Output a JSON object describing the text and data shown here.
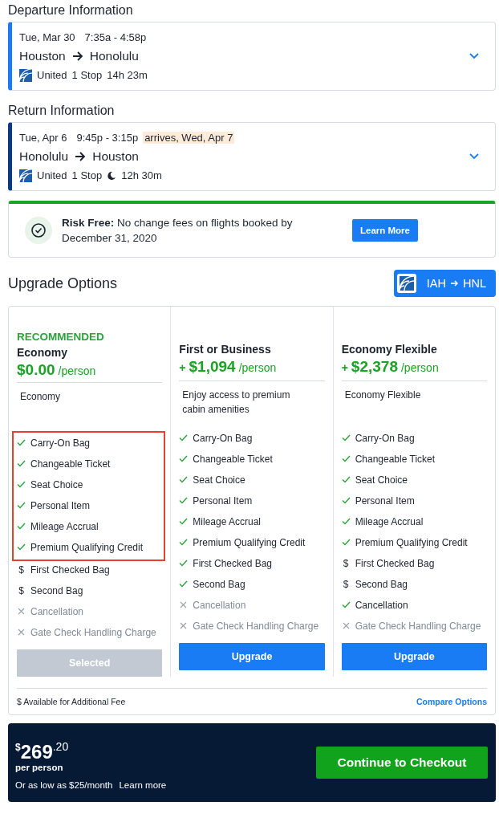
{
  "legs": [
    {
      "heading": "Departure Information",
      "color": "#1a7cf5",
      "date": "Tue, Mar 30",
      "times": "7:35a - 4:58p",
      "from": "Houston",
      "to": "Honolulu",
      "airline": "United",
      "stops": "1 Stop",
      "overnight": false,
      "duration": "14h 23m"
    },
    {
      "heading": "Return Information",
      "color": "#0a3a86",
      "date": "Tue, Apr 6",
      "times": "9:45p - 3:15p",
      "arrival_note": "arrives, Wed, Apr 7",
      "from": "Honolulu",
      "to": "Houston",
      "airline": "United",
      "stops": "1 Stop",
      "overnight": true,
      "duration": "12h 30m"
    }
  ],
  "notice": {
    "title": "Risk Free:",
    "text": "No change fees on flights booked by December 31, 2020",
    "button": "Learn More"
  },
  "upgrade": {
    "title": "Upgrade Options",
    "route_from": "IAH",
    "route_to": "HNL",
    "columns": [
      {
        "badge": "RECOMMENDED",
        "name": "Economy",
        "price": "$0.00",
        "unit": "/person",
        "description": "Economy",
        "selected": true,
        "button": "Selected",
        "features": [
          {
            "kind": "included",
            "highlighted": true,
            "label": "Carry-On Bag"
          },
          {
            "kind": "included",
            "highlighted": true,
            "label": "Changeable Ticket"
          },
          {
            "kind": "included",
            "highlighted": true,
            "label": "Seat Choice"
          },
          {
            "kind": "included",
            "highlighted": true,
            "label": "Personal Item"
          },
          {
            "kind": "included",
            "highlighted": true,
            "label": "Mileage Accrual"
          },
          {
            "kind": "included",
            "highlighted": true,
            "label": "Premium Qualifying Credit"
          },
          {
            "kind": "fee",
            "symbol": "$",
            "highlighted": false,
            "label": "First Checked Bag"
          },
          {
            "kind": "fee",
            "symbol": "$",
            "highlighted": false,
            "label": "Second Bag"
          },
          {
            "kind": "excluded",
            "highlighted": false,
            "label": "Cancellation"
          },
          {
            "kind": "excluded",
            "highlighted": false,
            "label": "Gate Check Handling Charge"
          }
        ]
      },
      {
        "name": "First or Business",
        "prefix": "+",
        "price": "$1,094",
        "unit": "/person",
        "description": "Enjoy access to premium cabin amenities",
        "selected": false,
        "button": "Upgrade",
        "features": [
          {
            "kind": "included",
            "highlighted": false,
            "label": "Carry-On Bag"
          },
          {
            "kind": "included",
            "highlighted": false,
            "label": "Changeable Ticket"
          },
          {
            "kind": "included",
            "highlighted": false,
            "label": "Seat Choice"
          },
          {
            "kind": "included",
            "highlighted": false,
            "label": "Personal Item"
          },
          {
            "kind": "included",
            "highlighted": false,
            "label": "Mileage Accrual"
          },
          {
            "kind": "included",
            "highlighted": false,
            "label": "Premium Qualifying Credit"
          },
          {
            "kind": "included",
            "highlighted": false,
            "label": "First Checked Bag"
          },
          {
            "kind": "included",
            "highlighted": false,
            "label": "Second Bag"
          },
          {
            "kind": "excluded",
            "highlighted": false,
            "label": "Cancellation"
          },
          {
            "kind": "excluded",
            "highlighted": false,
            "label": "Gate Check Handling Charge"
          }
        ]
      },
      {
        "name": "Economy Flexible",
        "prefix": "+",
        "price": "$2,378",
        "unit": "/person",
        "description": "Economy Flexible",
        "selected": false,
        "button": "Upgrade",
        "features": [
          {
            "kind": "included",
            "highlighted": false,
            "label": "Carry-On Bag"
          },
          {
            "kind": "included",
            "highlighted": false,
            "label": "Changeable Ticket"
          },
          {
            "kind": "included",
            "highlighted": false,
            "label": "Seat Choice"
          },
          {
            "kind": "included",
            "highlighted": false,
            "label": "Personal Item"
          },
          {
            "kind": "included",
            "highlighted": false,
            "label": "Mileage Accrual"
          },
          {
            "kind": "included",
            "highlighted": false,
            "label": "Premium Qualifying Credit"
          },
          {
            "kind": "fee",
            "symbol": "$",
            "highlighted": false,
            "label": "First Checked Bag"
          },
          {
            "kind": "fee",
            "symbol": "$",
            "highlighted": false,
            "label": "Second Bag"
          },
          {
            "kind": "included",
            "highlighted": false,
            "label": "Cancellation"
          },
          {
            "kind": "excluded",
            "highlighted": false,
            "label": "Gate Check Handling Charge"
          }
        ]
      }
    ],
    "footnote": "$ Available for Additional Fee",
    "compare_link": "Compare Options"
  },
  "checkout": {
    "currency": "$",
    "whole": "269",
    "cents": ".20",
    "per": "per person",
    "financing": "Or as low as $25/month",
    "financing_link": "Learn more",
    "button": "Continue to Checkout"
  }
}
